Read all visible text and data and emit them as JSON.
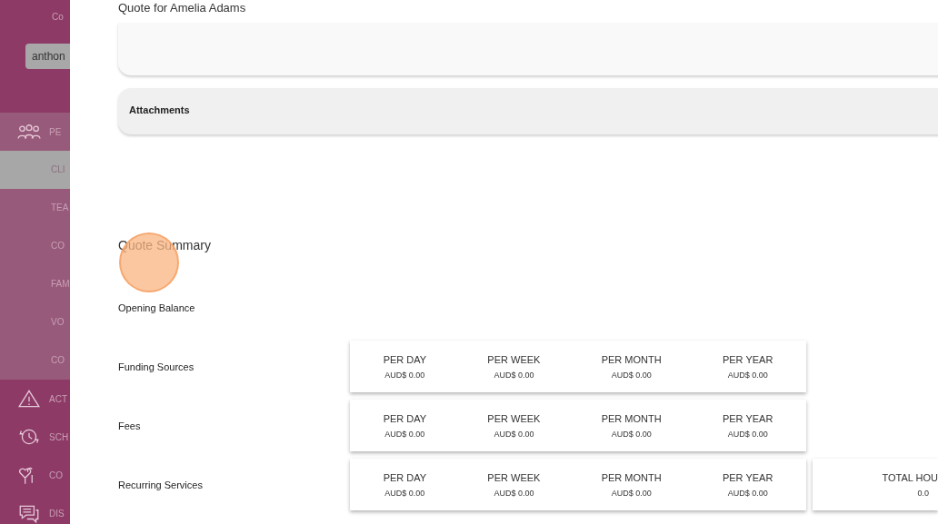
{
  "sidebar": {
    "header": "Co",
    "user_field": "anthon",
    "groups": [
      {
        "label": "PE",
        "selected": false,
        "expanded": true,
        "children": [
          {
            "label": "CLI",
            "selected": true
          },
          {
            "label": "TEA",
            "selected": false
          },
          {
            "label": "CO",
            "selected": false
          },
          {
            "label": "FAM",
            "selected": false
          },
          {
            "label": "VO",
            "selected": false
          },
          {
            "label": "CO",
            "selected": false
          }
        ]
      },
      {
        "label": "ACT",
        "selected": false,
        "expanded": false
      },
      {
        "label": "SCH",
        "selected": false,
        "expanded": false
      },
      {
        "label": "CO",
        "selected": false,
        "expanded": false
      },
      {
        "label": "DIS",
        "selected": false,
        "expanded": false
      }
    ]
  },
  "panel": {
    "title": "Quote for Amelia Adams",
    "attachments": {
      "label": "Attachments"
    },
    "summary": {
      "title": "Quote Summary",
      "rows": [
        {
          "label": "Opening Balance"
        },
        {
          "label": "Funding Sources",
          "cards": [
            {
              "cells": [
                {
                  "heading": "PER DAY",
                  "value": "AUD$ 0.00"
                },
                {
                  "heading": "PER WEEK",
                  "value": "AUD$ 0.00"
                },
                {
                  "heading": "PER MONTH",
                  "value": "AUD$ 0.00"
                },
                {
                  "heading": "PER YEAR",
                  "value": "AUD$ 0.00"
                }
              ]
            }
          ]
        },
        {
          "label": "Fees",
          "cards": [
            {
              "cells": [
                {
                  "heading": "PER DAY",
                  "value": "AUD$ 0.00"
                },
                {
                  "heading": "PER WEEK",
                  "value": "AUD$ 0.00"
                },
                {
                  "heading": "PER MONTH",
                  "value": "AUD$ 0.00"
                },
                {
                  "heading": "PER YEAR",
                  "value": "AUD$ 0.00"
                }
              ]
            }
          ]
        },
        {
          "label": "Recurring Services",
          "cards": [
            {
              "cells": [
                {
                  "heading": "PER DAY",
                  "value": "AUD$ 0.00"
                },
                {
                  "heading": "PER WEEK",
                  "value": "AUD$ 0.00"
                },
                {
                  "heading": "PER MONTH",
                  "value": "AUD$ 0.00"
                },
                {
                  "heading": "PER YEAR",
                  "value": "AUD$ 0.00"
                }
              ]
            },
            {
              "cells": [
                {
                  "heading": "TOTAL HOU",
                  "value": "0.0"
                }
              ]
            }
          ]
        }
      ]
    }
  }
}
